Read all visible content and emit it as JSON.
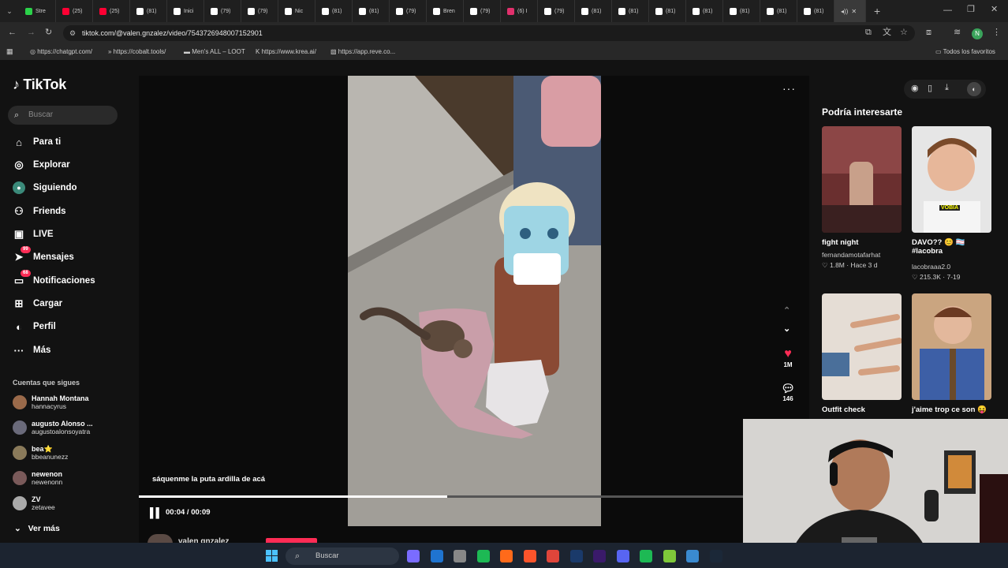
{
  "browser": {
    "tabs": [
      {
        "label": "Stre",
        "color": "#2bd24a"
      },
      {
        "label": "(25)",
        "color": "#ff0033"
      },
      {
        "label": "(25)",
        "color": "#ff0033"
      },
      {
        "label": "(81)",
        "color": "#ffffff"
      },
      {
        "label": "Inici",
        "color": "#ffffff"
      },
      {
        "label": "(79)",
        "color": "#ffffff"
      },
      {
        "label": "(79)",
        "color": "#ffffff"
      },
      {
        "label": "Nic",
        "color": "#ffffff"
      },
      {
        "label": "(81)",
        "color": "#ffffff"
      },
      {
        "label": "(81)",
        "color": "#ffffff"
      },
      {
        "label": "(79)",
        "color": "#ffffff"
      },
      {
        "label": "Bren",
        "color": "#ffffff"
      },
      {
        "label": "(79)",
        "color": "#ffffff"
      },
      {
        "label": "(6) I",
        "color": "#e1306c"
      },
      {
        "label": "(79)",
        "color": "#ffffff"
      },
      {
        "label": "(81)",
        "color": "#ffffff"
      },
      {
        "label": "(81)",
        "color": "#ffffff"
      },
      {
        "label": "(81)",
        "color": "#ffffff"
      },
      {
        "label": "(81)",
        "color": "#ffffff"
      },
      {
        "label": "(81)",
        "color": "#ffffff"
      },
      {
        "label": "(81)",
        "color": "#ffffff"
      },
      {
        "label": "(81)",
        "color": "#ffffff"
      }
    ],
    "url": "tiktok.com/@valen.gnzalez/video/7543726948007152901",
    "bookmarks": [
      "https://chatgpt.com/",
      "https://cobalt.tools/",
      "Men's ALL – LOOT",
      "https://www.krea.ai/",
      "https://app.reve.co..."
    ],
    "all_bookmarks": "Todos los favoritos"
  },
  "tiktok": {
    "logo": "TikTok",
    "search_placeholder": "Buscar",
    "nav": {
      "foryou": "Para ti",
      "explore": "Explorar",
      "following": "Siguiendo",
      "friends": "Friends",
      "live": "LIVE",
      "messages": "Mensajes",
      "messages_badge": "99",
      "notifications": "Notificaciones",
      "notifications_badge": "68",
      "upload": "Cargar",
      "profile": "Perfil",
      "more": "Más"
    },
    "following_title": "Cuentas que sigues",
    "following_accounts": [
      {
        "name": "Hannah Montana",
        "handle": "hannacyrus"
      },
      {
        "name": "augusto Alonso ...",
        "handle": "augustoalonsoyatra"
      },
      {
        "name": "bea⭐",
        "handle": "bbeanunezz"
      },
      {
        "name": "newenon",
        "handle": "newenonn"
      },
      {
        "name": "ZV",
        "handle": "zetavee"
      }
    ],
    "see_more": "Ver más",
    "video": {
      "caption": "sáquenme la puta ardilla de acá",
      "time": "00:04 / 00:09",
      "progress": 0.51,
      "likes": "1M",
      "comments": "146",
      "author": "valen gnzalez"
    },
    "recommended_title": "Podría interesarte",
    "recommended": [
      {
        "title": "fight night",
        "author": "fernandamotafarhat",
        "stats": "♡ 1.8M · Hace 3 d"
      },
      {
        "title": "DAVO?? 😊 🏳️‍⚧️ #lacobra",
        "author": "lacobraaa2.0",
        "stats": "♡ 215.3K · 7-19",
        "overlay": "VOBIA"
      },
      {
        "title": "Outfit check",
        "author": "",
        "stats": ""
      },
      {
        "title": "j'aime trop ce son 😝",
        "author": "",
        "stats": ""
      }
    ]
  },
  "taskbar": {
    "search": "Buscar"
  }
}
